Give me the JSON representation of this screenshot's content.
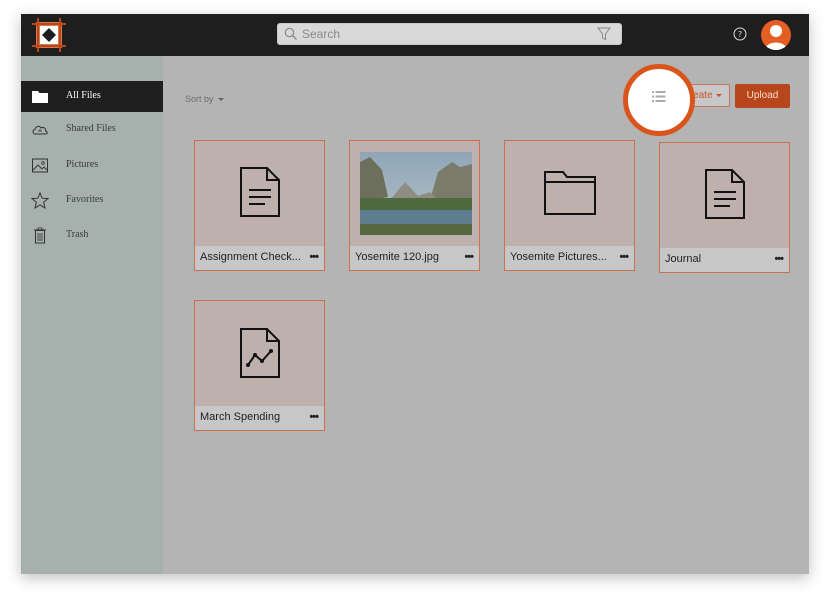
{
  "search": {
    "placeholder": "Search"
  },
  "sidebar": {
    "items": [
      {
        "label": "All Files",
        "icon": "folder-icon",
        "active": true
      },
      {
        "label": "Shared Files",
        "icon": "cloud-icon"
      },
      {
        "label": "Pictures",
        "icon": "picture-icon"
      },
      {
        "label": "Favorites",
        "icon": "star-icon"
      },
      {
        "label": "Trash",
        "icon": "trash-icon"
      }
    ]
  },
  "toolbar": {
    "sort_label": "Sort by",
    "create_label": "Create",
    "upload_label": "Upload"
  },
  "files": [
    {
      "name": "Assignment Check...",
      "icon": "document-icon",
      "more": "•••"
    },
    {
      "name": "Yosemite 120.jpg",
      "icon": "image-thumbnail",
      "more": "•••"
    },
    {
      "name": "Yosemite Pictures...",
      "icon": "folder-icon",
      "more": "•••"
    },
    {
      "name": "Journal",
      "icon": "document-icon",
      "more": "•••"
    },
    {
      "name": "March Spending",
      "icon": "chart-document-icon",
      "more": "•••"
    }
  ],
  "colors": {
    "accent": "#b8461d",
    "highlight_ring": "#d9551c",
    "sidebar_bg": "#a6b0ad",
    "topbar_bg": "#1e1e1e"
  }
}
